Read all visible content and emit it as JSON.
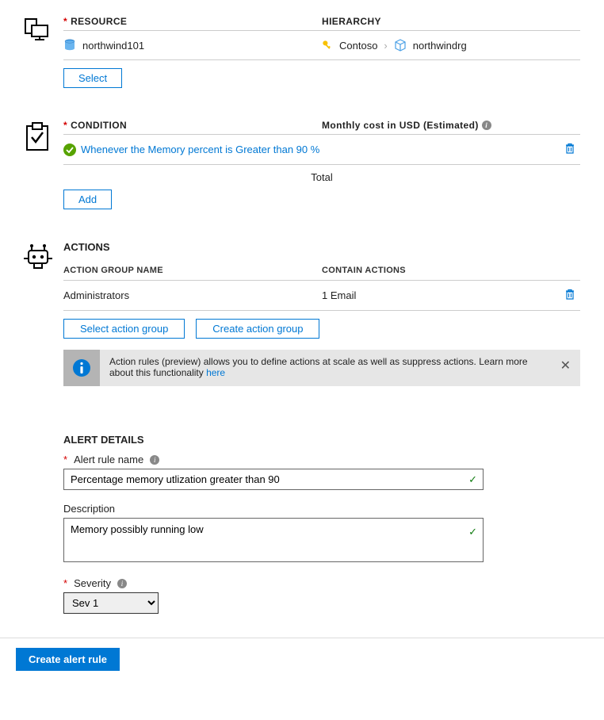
{
  "resource": {
    "header_label": "RESOURCE",
    "hierarchy_label": "HIERARCHY",
    "name": "northwind101",
    "hierarchy_root": "Contoso",
    "hierarchy_child": "northwindrg",
    "select_btn": "Select"
  },
  "condition": {
    "header_label": "CONDITION",
    "cost_label": "Monthly cost in USD (Estimated)",
    "rule_text": "Whenever the Memory percent is Greater than 90 %",
    "total_label": "Total",
    "add_btn": "Add"
  },
  "actions": {
    "header": "ACTIONS",
    "col_group": "ACTION GROUP NAME",
    "col_contain": "CONTAIN ACTIONS",
    "group_name": "Administrators",
    "contain_value": "1 Email",
    "select_group_btn": "Select action group",
    "create_group_btn": "Create action group",
    "info_text_1": "Action rules (preview) allows you to define actions at scale as well as suppress actions. Learn more about this functionality ",
    "info_link": "here"
  },
  "details": {
    "header": "ALERT DETAILS",
    "name_label": "Alert rule name",
    "name_value": "Percentage memory utlization greater than 90",
    "desc_label": "Description",
    "desc_value": "Memory possibly running low",
    "severity_label": "Severity",
    "severity_value": "Sev 1"
  },
  "footer": {
    "create_btn": "Create alert rule"
  }
}
